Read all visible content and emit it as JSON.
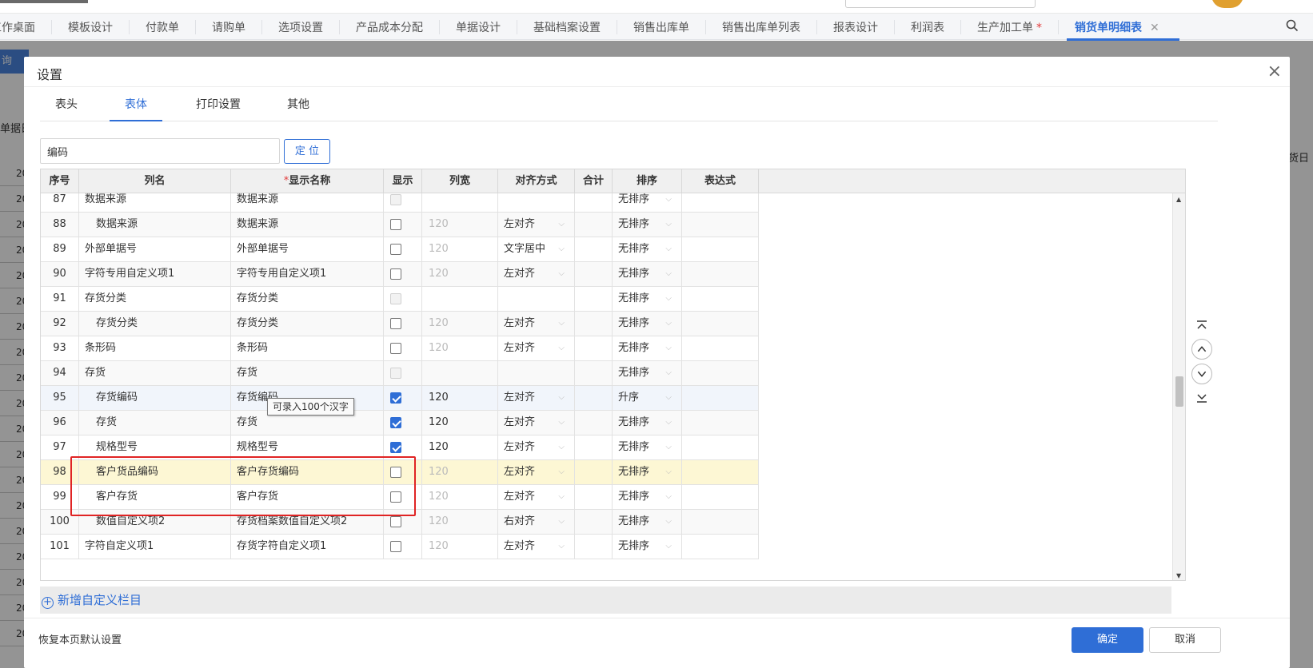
{
  "tabs": [
    {
      "label": "工作桌面"
    },
    {
      "label": "模板设计"
    },
    {
      "label": "付款单"
    },
    {
      "label": "请购单"
    },
    {
      "label": "选项设置"
    },
    {
      "label": "产品成本分配"
    },
    {
      "label": "单据设计"
    },
    {
      "label": "基础档案设置"
    },
    {
      "label": "销售出库单"
    },
    {
      "label": "销售出库单列表"
    },
    {
      "label": "报表设计"
    },
    {
      "label": "利润表"
    },
    {
      "label": "生产加工单",
      "dirty": "*"
    },
    {
      "label": "销货单明细表",
      "active": true,
      "close": "✕"
    }
  ],
  "background": {
    "query_button": "询",
    "date_label": "单据日",
    "right_label": "发货日",
    "row_prefix": "20"
  },
  "dialog": {
    "title": "设置",
    "close": "×",
    "subtabs": [
      "表头",
      "表体",
      "打印设置",
      "其他"
    ],
    "active_subtab": "表体",
    "search_value": "编码",
    "locate_button": "定 位",
    "columns": {
      "seq": "序号",
      "name": "列名",
      "required_mark": "*",
      "display_name": "显示名称",
      "show": "显示",
      "width": "列宽",
      "align": "对齐方式",
      "sum": "合计",
      "sort": "排序",
      "expr": "表达式"
    },
    "rows": [
      {
        "seq": "87",
        "name": "数据来源",
        "indent": false,
        "display": "数据来源",
        "show": "disabled",
        "width": "",
        "align": "",
        "sort": "无排序"
      },
      {
        "seq": "88",
        "name": "数据来源",
        "indent": true,
        "display": "数据来源",
        "show": "unchecked",
        "width": "120",
        "align": "左对齐",
        "sort": "无排序"
      },
      {
        "seq": "89",
        "name": "外部单据号",
        "indent": false,
        "display": "外部单据号",
        "show": "unchecked",
        "width": "120",
        "align": "文字居中",
        "sort": "无排序"
      },
      {
        "seq": "90",
        "name": "字符专用自定义项1",
        "indent": false,
        "display": "字符专用自定义项1",
        "show": "unchecked",
        "width": "120",
        "align": "左对齐",
        "sort": "无排序"
      },
      {
        "seq": "91",
        "name": "存货分类",
        "indent": false,
        "display": "存货分类",
        "show": "disabled",
        "width": "",
        "align": "",
        "sort": "无排序"
      },
      {
        "seq": "92",
        "name": "存货分类",
        "indent": true,
        "display": "存货分类",
        "show": "unchecked",
        "width": "120",
        "align": "左对齐",
        "sort": "无排序"
      },
      {
        "seq": "93",
        "name": "条形码",
        "indent": false,
        "display": "条形码",
        "show": "unchecked",
        "width": "120",
        "align": "左对齐",
        "sort": "无排序"
      },
      {
        "seq": "94",
        "name": "存货",
        "indent": false,
        "display": "存货",
        "show": "disabled",
        "width": "",
        "align": "",
        "sort": "无排序"
      },
      {
        "seq": "95",
        "name": "存货编码",
        "indent": true,
        "display": "存货编码",
        "show": "checked",
        "width": "120",
        "align": "左对齐",
        "sort": "升序",
        "state": "hover"
      },
      {
        "seq": "96",
        "name": "存货",
        "indent": true,
        "display": "存货",
        "show": "checked",
        "width": "120",
        "align": "左对齐",
        "sort": "无排序"
      },
      {
        "seq": "97",
        "name": "规格型号",
        "indent": true,
        "display": "规格型号",
        "show": "checked",
        "width": "120",
        "align": "左对齐",
        "sort": "无排序"
      },
      {
        "seq": "98",
        "name": "客户货品编码",
        "indent": true,
        "display": "客户存货编码",
        "show": "unchecked",
        "width": "120",
        "align": "左对齐",
        "sort": "无排序",
        "state": "selected"
      },
      {
        "seq": "99",
        "name": "客户存货",
        "indent": true,
        "display": "客户存货",
        "show": "unchecked",
        "width": "120",
        "align": "左对齐",
        "sort": "无排序"
      },
      {
        "seq": "100",
        "name": "数值自定义项2",
        "indent": true,
        "display": "存货档案数值自定义项2",
        "show": "unchecked",
        "width": "120",
        "align": "右对齐",
        "sort": "无排序"
      },
      {
        "seq": "101",
        "name": "字符自定义项1",
        "indent": false,
        "display": "存货字符自定义项1",
        "show": "unchecked",
        "width": "120",
        "align": "左对齐",
        "sort": "无排序"
      }
    ],
    "tooltip": "可录入100个汉字",
    "add_custom": "新增自定义栏目",
    "restore_default": "恢复本页默认设置",
    "ok_button": "确定",
    "cancel_button": "取消"
  },
  "colors": {
    "accent": "#2f6ed6",
    "highlight_box": "#e02424",
    "selected_row": "#fdf7d4"
  }
}
